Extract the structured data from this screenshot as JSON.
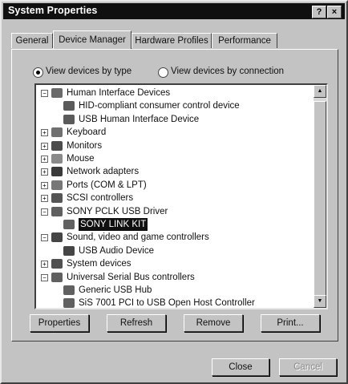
{
  "window": {
    "title": "System Properties",
    "help_glyph": "?",
    "close_glyph": "×"
  },
  "tabs": [
    {
      "label": "General"
    },
    {
      "label": "Device Manager"
    },
    {
      "label": "Hardware Profiles"
    },
    {
      "label": "Performance"
    }
  ],
  "view_options": [
    {
      "label": "View devices by type",
      "selected": true
    },
    {
      "label": "View devices by connection",
      "selected": false
    }
  ],
  "tree": [
    {
      "label": "Human Interface Devices",
      "level": 0,
      "expander": "−",
      "icon": "hid-icon"
    },
    {
      "label": "HID-compliant consumer control device",
      "level": 1,
      "expander": "",
      "icon": "hid-device-icon"
    },
    {
      "label": "USB Human Interface Device",
      "level": 1,
      "expander": "",
      "icon": "hid-device-icon"
    },
    {
      "label": "Keyboard",
      "level": 0,
      "expander": "+",
      "icon": "keyboard-icon"
    },
    {
      "label": "Monitors",
      "level": 0,
      "expander": "+",
      "icon": "monitor-icon"
    },
    {
      "label": "Mouse",
      "level": 0,
      "expander": "+",
      "icon": "mouse-icon"
    },
    {
      "label": "Network adapters",
      "level": 0,
      "expander": "+",
      "icon": "network-icon"
    },
    {
      "label": "Ports (COM & LPT)",
      "level": 0,
      "expander": "+",
      "icon": "port-icon"
    },
    {
      "label": "SCSI controllers",
      "level": 0,
      "expander": "+",
      "icon": "scsi-icon"
    },
    {
      "label": "SONY PCLK USB Driver",
      "level": 0,
      "expander": "−",
      "icon": "usb-icon"
    },
    {
      "label": "SONY LINK KIT",
      "level": 1,
      "expander": "",
      "icon": "usb-icon",
      "selected": true
    },
    {
      "label": "Sound, video and game controllers",
      "level": 0,
      "expander": "−",
      "icon": "sound-icon"
    },
    {
      "label": "USB Audio Device",
      "level": 1,
      "expander": "",
      "icon": "sound-icon"
    },
    {
      "label": "System devices",
      "level": 0,
      "expander": "+",
      "icon": "system-icon"
    },
    {
      "label": "Universal Serial Bus controllers",
      "level": 0,
      "expander": "−",
      "icon": "usb-icon"
    },
    {
      "label": "Generic USB Hub",
      "level": 1,
      "expander": "",
      "icon": "usb-icon"
    },
    {
      "label": "SiS 7001 PCI to USB Open Host Controller",
      "level": 1,
      "expander": "",
      "icon": "usb-icon"
    }
  ],
  "scrollbar": {
    "up_glyph": "▲",
    "down_glyph": "▼"
  },
  "actions": [
    {
      "label": "Properties"
    },
    {
      "label": "Refresh"
    },
    {
      "label": "Remove"
    },
    {
      "label": "Print..."
    }
  ],
  "footer": {
    "close_label": "Close",
    "cancel_label": "Cancel"
  }
}
